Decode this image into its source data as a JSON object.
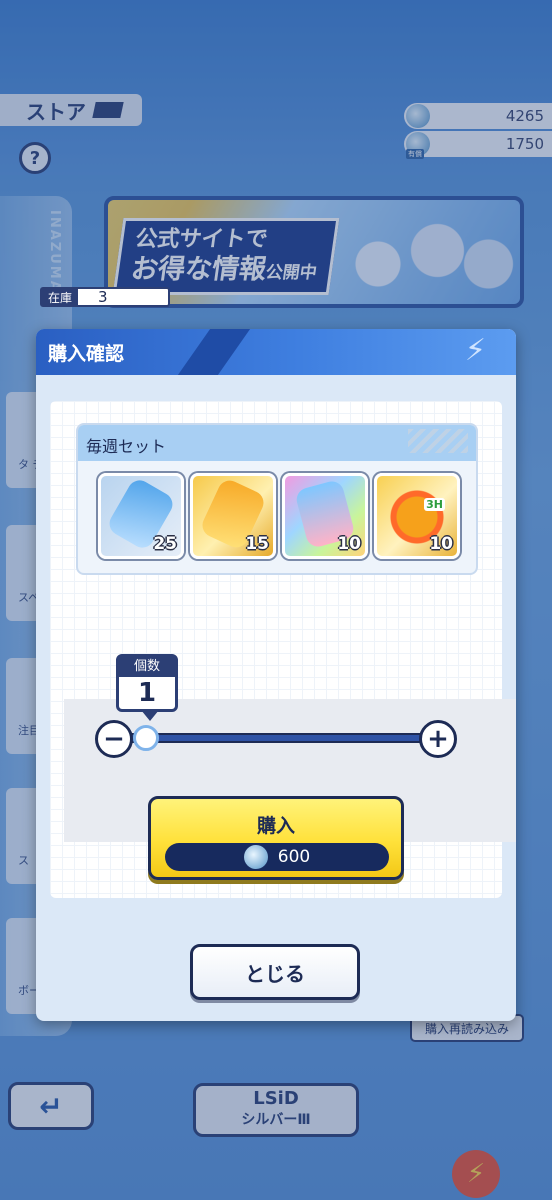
{
  "store": {
    "title": "ストア",
    "help_label": "?",
    "currency_1": "4265",
    "currency_2": "1750",
    "currency_2_tag": "有償",
    "side_brand": "INAZUMA",
    "side_items": [
      "タ\nチ",
      "スペ",
      "注目",
      "ス",
      "ボー"
    ],
    "banner_line1": "公式サイトで",
    "banner_line2_big": "お得な情報",
    "banner_line2_small": "公開中",
    "reload_label": "購入再読み込み",
    "back_icon": "back-arrow-icon",
    "rank_logo": "LSiD",
    "rank_label": "シルバーⅢ"
  },
  "modal": {
    "title": "購入確認",
    "set_title": "毎週セット",
    "items": [
      {
        "icon": "water-bottle-icon",
        "qty": "25"
      },
      {
        "icon": "gold-drink-bottle-icon",
        "qty": "15"
      },
      {
        "icon": "rainbow-drink-bottle-icon",
        "qty": "10"
      },
      {
        "icon": "flame-glove-icon",
        "qty": "10",
        "time": "3H"
      }
    ],
    "stock_label": "在庫",
    "stock_value": "3",
    "count_label": "個数",
    "count_value": "1",
    "slider_fraction": 0,
    "minus_label": "−",
    "plus_label": "+",
    "buy_label": "購入",
    "buy_price": "600",
    "close_label": "とじる"
  },
  "colors": {
    "accent": "#2c3f75",
    "header_blue": "#2a5fc2",
    "buy_yellow": "#ffe13a"
  }
}
